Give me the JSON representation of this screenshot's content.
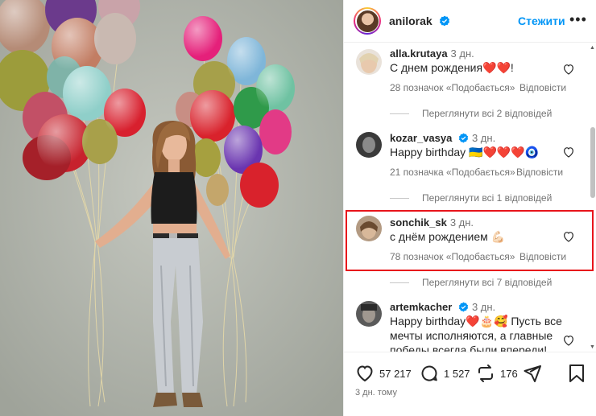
{
  "header": {
    "username": "anilorak",
    "follow_label": "Стежити",
    "more_label": "•••"
  },
  "comments": [
    {
      "username": "alla.krutaya",
      "time": "3 дн.",
      "text": "С днем рождения❤️❤️!",
      "likes": "28 позначок «Подобається»",
      "reply": "Відповісти",
      "view_replies": "Переглянути всі 2 відповідей"
    },
    {
      "username": "kozar_vasya",
      "time": "3 дн.",
      "text": "Happy birthday 🇺🇦❤️❤️❤️🧿",
      "likes": "21 позначка «Подобається»",
      "reply": "Відповісти",
      "view_replies": "Переглянути всі 1 відповідей"
    },
    {
      "username": "sonchik_sk",
      "time": "3 дн.",
      "text": "с днём рождением 💪🏻",
      "likes": "78 позначок «Подобається»",
      "reply": "Відповісти",
      "view_replies": "Переглянути всі 7 відповідей"
    },
    {
      "username": "artemkacher",
      "time": "3 дн.",
      "text_line1": "Happy birthday❤️🎂🥰 Пусть все",
      "text_line2": "мечты исполняются, а главные",
      "text_line3": "победы всегда были впереди!"
    }
  ],
  "actions": {
    "likes_count": "57 217",
    "comments_count": "1 527",
    "reposts_count": "176",
    "time_ago": "3 дн. тому"
  },
  "icons": {
    "like": "heart-icon",
    "comment": "comment-icon",
    "repost": "repost-icon",
    "share": "share-icon",
    "save": "bookmark-icon",
    "verified": "verified-badge-icon"
  },
  "colors": {
    "accent": "#0095f6",
    "highlight": "#e8141b",
    "muted": "#737373"
  }
}
